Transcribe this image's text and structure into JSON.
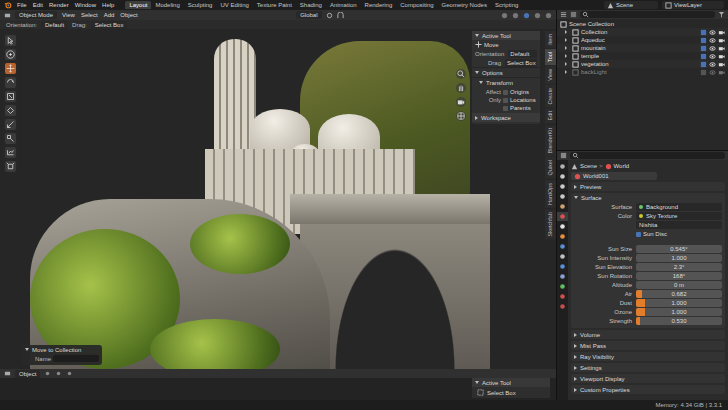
{
  "menu": [
    "File",
    "Edit",
    "Render",
    "Window",
    "Help"
  ],
  "workspaces": [
    {
      "label": "Layout",
      "selected": true
    },
    {
      "label": "Modeling",
      "selected": false
    },
    {
      "label": "Sculpting",
      "selected": false
    },
    {
      "label": "UV Editing",
      "selected": false
    },
    {
      "label": "Texture Paint",
      "selected": false
    },
    {
      "label": "Shading",
      "selected": false
    },
    {
      "label": "Animation",
      "selected": false
    },
    {
      "label": "Rendering",
      "selected": false
    },
    {
      "label": "Compositing",
      "selected": false
    },
    {
      "label": "Geometry Nodes",
      "selected": false
    },
    {
      "label": "Scripting",
      "selected": false
    }
  ],
  "scene_field": "Scene",
  "view_layer_field": "ViewLayer",
  "viewport_header": {
    "mode": "Object Mode",
    "menus": [
      "View",
      "Select",
      "Add",
      "Object"
    ],
    "transform": "Global"
  },
  "tool_settings": {
    "orientation_label": "Orientation:",
    "orientation": "Default",
    "drag_label": "Drag:",
    "drag": "Select Box"
  },
  "toolbar": [
    {
      "selected": false
    },
    {
      "selected": false
    },
    {
      "selected": true
    },
    {
      "selected": false
    },
    {
      "selected": false
    },
    {
      "selected": false
    },
    {
      "selected": false
    },
    {
      "selected": false
    },
    {
      "selected": false
    },
    {
      "selected": false
    }
  ],
  "npanel": {
    "header": "Active Tool",
    "tool": "Move",
    "orientation_label": "Orientation",
    "orientation": "Default",
    "drag_label": "Drag",
    "drag": "Select Box",
    "options": "Options",
    "transform": "Transform",
    "affect_label": "Affect Only",
    "affect": [
      {
        "label": "Origins",
        "checked": false
      },
      {
        "label": "Locations",
        "checked": false
      },
      {
        "label": "Parents",
        "checked": false
      }
    ],
    "workspace": "Workspace"
  },
  "side_tabs": [
    {
      "label": "Item",
      "selected": false
    },
    {
      "label": "Tool",
      "selected": true
    },
    {
      "label": "View",
      "selected": false
    },
    {
      "label": "Create",
      "selected": false
    },
    {
      "label": "Edit",
      "selected": false
    },
    {
      "label": "BlenderKit",
      "selected": false
    },
    {
      "label": "Quixel",
      "selected": false
    },
    {
      "label": "HardOps",
      "selected": false
    },
    {
      "label": "Sketchfab",
      "selected": false
    }
  ],
  "redo_panel": {
    "title": "Move to Collection",
    "name_label": "Name",
    "name_value": ""
  },
  "timeline_header": {
    "mode": "Object"
  },
  "active_tool_panel": {
    "title": "Active Tool",
    "tool": "Select Box"
  },
  "outliner": {
    "root": "Scene Collection",
    "items": [
      {
        "name": "Collection",
        "disabled": false
      },
      {
        "name": "Aqueduc",
        "disabled": false
      },
      {
        "name": "mountain",
        "disabled": false
      },
      {
        "name": "temple",
        "disabled": false
      },
      {
        "name": "vegetation",
        "disabled": false
      },
      {
        "name": "backLight",
        "disabled": true
      }
    ]
  },
  "properties": {
    "tabs": [
      {
        "selected": false,
        "color": "#b0b0b0"
      },
      {
        "selected": false,
        "color": "#c8c8c8"
      },
      {
        "selected": false,
        "color": "#c8c8c8"
      },
      {
        "selected": false,
        "color": "#c8c8c8"
      },
      {
        "selected": false,
        "color": "#d0a070"
      },
      {
        "selected": true,
        "color": "#e05050"
      },
      {
        "selected": false,
        "color": "#e0e0e0"
      },
      {
        "selected": false,
        "color": "#e89040"
      },
      {
        "selected": false,
        "color": "#5a8fd8"
      },
      {
        "selected": false,
        "color": "#c0c0c0"
      },
      {
        "selected": false,
        "color": "#5a8fd8"
      },
      {
        "selected": false,
        "color": "#8a9fd8"
      },
      {
        "selected": false,
        "color": "#60c060"
      },
      {
        "selected": false,
        "color": "#d05050"
      },
      {
        "selected": false,
        "color": "#c05050"
      }
    ],
    "breadcrumb": {
      "scene": "Scene",
      "separator": ">",
      "world": "World"
    },
    "world_name": "World001",
    "sections": [
      {
        "label": "Preview",
        "expanded": false,
        "fields": []
      },
      {
        "label": "Surface",
        "expanded": true,
        "fields": [
          {
            "kind": "dropdown",
            "label": "Surface",
            "value": "Background",
            "color": "#6cc36c"
          },
          {
            "kind": "dropdown",
            "label": "Color",
            "value": "Sky Texture",
            "color": "#c7c729"
          },
          {
            "kind": "dropdown",
            "label": "",
            "value": "Nishita",
            "color": ""
          },
          {
            "kind": "checkbox",
            "label": "Sun Disc",
            "checked": true
          },
          {
            "kind": "number",
            "label": "Sun Size",
            "value": "0.545°"
          },
          {
            "kind": "number",
            "label": "Sun Intensity",
            "value": "1.000"
          },
          {
            "kind": "number",
            "label": "Sun Elevation",
            "value": "2.3°"
          },
          {
            "kind": "number",
            "label": "Sun Rotation",
            "value": "168°"
          },
          {
            "kind": "number",
            "label": "Altitude",
            "value": "0 m"
          },
          {
            "kind": "slider",
            "label": "Air",
            "value": "0.682",
            "level": 0.07
          },
          {
            "kind": "slider",
            "label": "Dust",
            "value": "1.000",
            "level": 0.1
          },
          {
            "kind": "slider",
            "label": "Ozone",
            "value": "1.000",
            "level": 0.1
          },
          {
            "kind": "slider",
            "label": "Strength",
            "value": "0.530",
            "level": 0.05
          }
        ]
      },
      {
        "label": "Volume",
        "expanded": false,
        "fields": []
      },
      {
        "label": "Mist Pass",
        "expanded": false,
        "fields": []
      },
      {
        "label": "Ray Visibility",
        "expanded": false,
        "fields": []
      },
      {
        "label": "Settings",
        "expanded": false,
        "fields": []
      },
      {
        "label": "Viewport Display",
        "expanded": false,
        "fields": []
      },
      {
        "label": "Custom Properties",
        "expanded": false,
        "fields": []
      }
    ]
  },
  "status_bar": {
    "memory": "Memory: 4.34 GiB | 3.3.1"
  }
}
